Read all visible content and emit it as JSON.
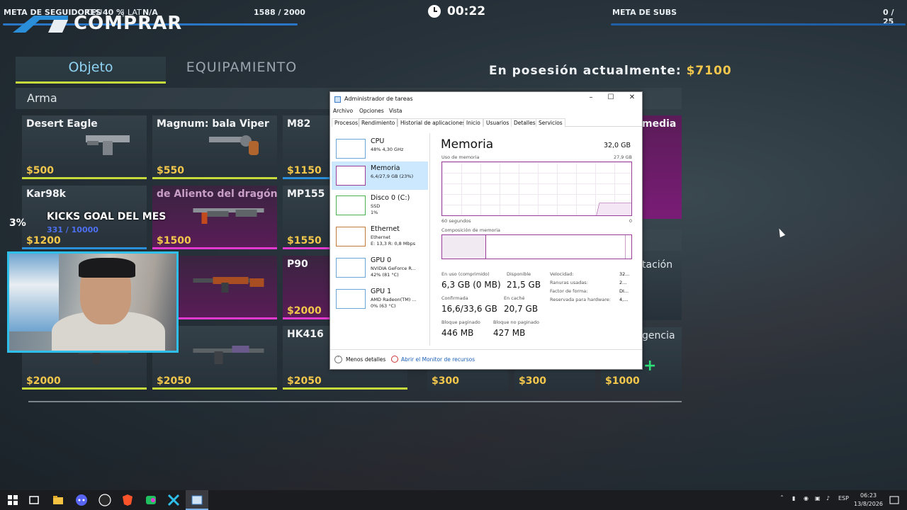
{
  "overlay": {
    "followers_label": "META DE SEGUIDORES",
    "cpu_label": "CPU",
    "cpu_value": "40 %",
    "lat_label": "LAT",
    "lat_value": "N/A",
    "followers_progress": "1588 / 2000",
    "timer": "00:22",
    "subs_label": "META DE SUBS",
    "subs_progress": "0 / 25",
    "kicks_title": "KICKS GOAL DEL MES",
    "kicks_progress": "331 / 10000",
    "kicks_percent": "3%"
  },
  "game": {
    "buy_title": "COMPRAR",
    "tabs": [
      "Objeto",
      "EQUIPAMIENTO"
    ],
    "money_label": "En posesión actualmente:",
    "money_value": "$7100",
    "category": "Arma",
    "weapons": [
      {
        "name": "Desert Eagle",
        "price": "$500"
      },
      {
        "name": "Magnum: bala Viper",
        "price": "$550"
      },
      {
        "name": "M82",
        "price": "$1150"
      },
      {
        "name": "Kar98k",
        "price": "$1200"
      },
      {
        "name": "de Aliento del dragón",
        "price": "$1500"
      },
      {
        "name": "MP155",
        "price": "$1550"
      },
      {
        "name": "",
        "price": ""
      },
      {
        "name": "",
        "price": "50"
      },
      {
        "name": "P90",
        "price": "$2000"
      },
      {
        "name": "",
        "price": "$2000"
      },
      {
        "name": "-6",
        "price": "$2050"
      },
      {
        "name": "HK416",
        "price": "$2050"
      }
    ],
    "equipment": [
      {
        "name": "media",
        "price": ""
      },
      {
        "name": "tación",
        "price": ""
      },
      {
        "name": "",
        "price": "$300"
      },
      {
        "name": "",
        "price": "$300"
      },
      {
        "name": "gencia",
        "price": "$1000"
      }
    ]
  },
  "task_manager": {
    "title": "Administrador de tareas",
    "menu": [
      "Archivo",
      "Opciones",
      "Vista"
    ],
    "tabs": [
      "Procesos",
      "Rendimiento",
      "Historial de aplicaciones",
      "Inicio",
      "Usuarios",
      "Detalles",
      "Servicios"
    ],
    "sidebar": [
      {
        "name": "CPU",
        "line2": "48% 4,30 GHz",
        "line3": ""
      },
      {
        "name": "Memoria",
        "line2": "6,4/27,9 GB (23%)",
        "line3": ""
      },
      {
        "name": "Disco 0 (C:)",
        "line2": "SSD",
        "line3": "1%"
      },
      {
        "name": "Ethernet",
        "line2": "Ethernet",
        "line3": "E: 13,3 R: 0,8 Mbps"
      },
      {
        "name": "GPU 0",
        "line2": "NVIDIA GeForce R...",
        "line3": "42% (81 °C)"
      },
      {
        "name": "GPU 1",
        "line2": "AMD Radeon(TM) ...",
        "line3": "0% (63 °C)"
      }
    ],
    "memory": {
      "title": "Memoria",
      "total": "32,0 GB",
      "usage_label": "Uso de memoria",
      "usage_max": "27,9 GB",
      "time_left": "60 segundos",
      "time_right": "0",
      "composition_label": "Composición de memoria",
      "in_use_label": "En uso (comprimido)",
      "in_use_value": "6,3 GB (0 MB)",
      "available_label": "Disponible",
      "available_value": "21,5 GB",
      "committed_label": "Confirmada",
      "committed_value": "16,6/33,6 GB",
      "cached_label": "En caché",
      "cached_value": "20,7 GB",
      "paged_label": "Bloque paginado",
      "paged_value": "446 MB",
      "nonpaged_label": "Bloque no paginado",
      "nonpaged_value": "427 MB",
      "speed_label": "Velocidad:",
      "speed_value": "32...",
      "slots_label": "Ranuras usadas:",
      "slots_value": "2...",
      "form_label": "Factor de forma:",
      "form_value": "DI...",
      "reserved_label": "Reservada para hardware:",
      "reserved_value": "4,..."
    },
    "footer_less": "Menos detalles",
    "footer_monitor": "Abrir el Monitor de recursos"
  },
  "taskbar": {
    "lang": "ESP",
    "time": "06:23",
    "date": "13/8/2026"
  }
}
